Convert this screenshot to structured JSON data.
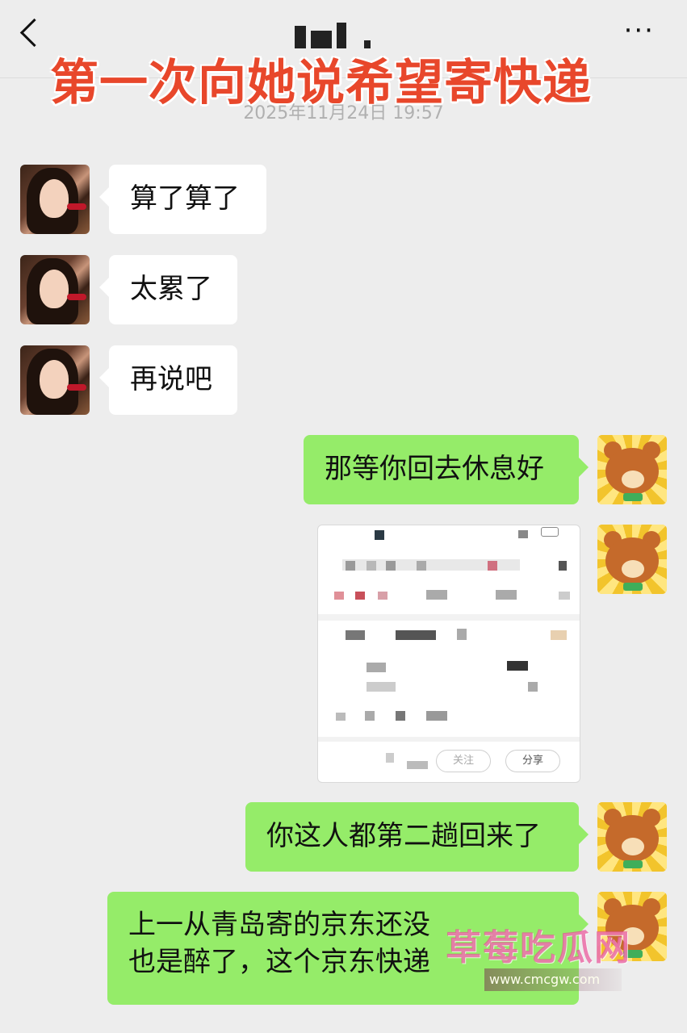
{
  "header": {
    "contact_name": "",
    "back_label": "‹",
    "more_label": "···"
  },
  "overlay_title": "第一次向她说希望寄快递",
  "timestamp": "2025年11月24日 19:57",
  "messages": [
    {
      "side": "left",
      "text": "算了算了"
    },
    {
      "side": "left",
      "text": "太累了"
    },
    {
      "side": "left",
      "text": "再说吧"
    },
    {
      "side": "right",
      "text": "那等你回去休息好"
    },
    {
      "side": "right",
      "type": "image"
    },
    {
      "side": "right",
      "text": "你这人都第二趟回来了"
    },
    {
      "side": "right",
      "text": "上一从青岛寄的京东还没",
      "text2": "也是醉了，这个京东快递"
    }
  ],
  "shared_image": {
    "follow_label": "关注",
    "share_label": "分享"
  },
  "watermark": {
    "text": "草莓吃瓜网",
    "url": "www.cmcgw.com"
  },
  "colors": {
    "background": "#ededed",
    "bubble_self": "#95ec69",
    "bubble_other": "#ffffff",
    "overlay_title": "#e8472b"
  }
}
